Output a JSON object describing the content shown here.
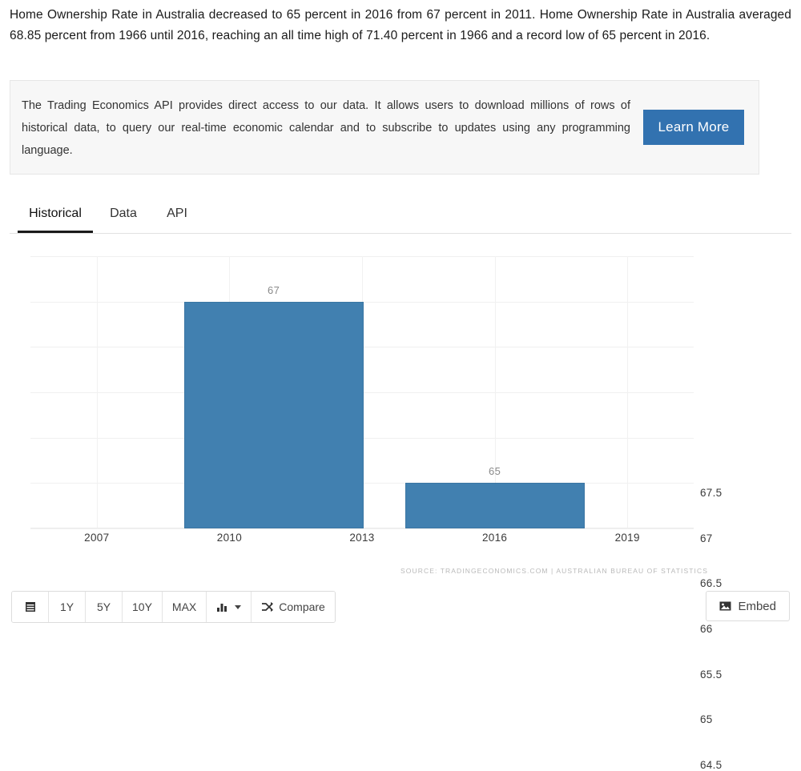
{
  "intro": {
    "text": "Home Ownership Rate in Australia decreased to 65 percent in 2016 from 67 percent in 2011. Home Ownership Rate in Australia averaged 68.85 percent from 1966 until 2016, reaching an all time high of 71.40 percent in 1966 and a record low of 65 percent in 2016."
  },
  "promo": {
    "text": "The Trading Economics API provides direct access to our data. It allows users to download millions of rows of historical data, to query our real-time economic calendar and to subscribe to updates using any programming language.",
    "button_label": "Learn More",
    "button_color": "#3272b0"
  },
  "tabs": [
    {
      "label": "Historical",
      "active": true
    },
    {
      "label": "Data",
      "active": false
    },
    {
      "label": "API",
      "active": false
    }
  ],
  "chart_data": {
    "type": "bar",
    "title": "",
    "xlabel": "",
    "ylabel": "",
    "categories": [
      "2011",
      "2016"
    ],
    "values": [
      67,
      65
    ],
    "value_labels": [
      "67",
      "65"
    ],
    "ylim": [
      64.5,
      67.5
    ],
    "yticks": [
      "67.5",
      "67",
      "66.5",
      "66",
      "65.5",
      "65",
      "64.5"
    ],
    "ytick_values": [
      67.5,
      67,
      66.5,
      66,
      65.5,
      65,
      64.5
    ],
    "xticks": [
      "2007",
      "2010",
      "2013",
      "2016",
      "2019"
    ],
    "xtick_values": [
      2007,
      2010,
      2013,
      2016,
      2019
    ],
    "xlim": [
      2005.5,
      2020.5
    ],
    "grid": true,
    "legend": "none",
    "bar_color": "#4180b0",
    "source": "SOURCE: TRADINGECONOMICS.COM | AUSTRALIAN BUREAU OF STATISTICS"
  },
  "toolbar": {
    "calendar_label": "",
    "ranges": [
      "1Y",
      "5Y",
      "10Y",
      "MAX"
    ],
    "chart_type_label": "",
    "compare_label": "Compare",
    "embed_label": "Embed"
  }
}
